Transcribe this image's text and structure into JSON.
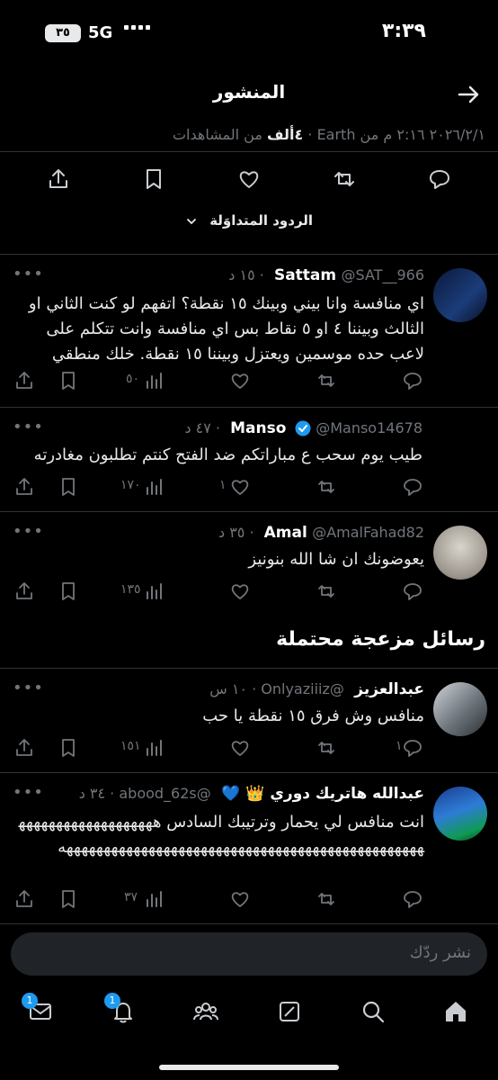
{
  "status_bar": {
    "time": "٣:٣٩",
    "network": "5G",
    "battery": "٣٥"
  },
  "header": {
    "title": "المنشور"
  },
  "post_meta": {
    "date_time": "٢٠٢٦/٢/١ ٢:١٦ م من Earth ·",
    "views_count": "٤ألف",
    "views_label": "من المشاهدات"
  },
  "sort": {
    "label": "الردود المتداوَلة"
  },
  "replies": [
    {
      "name": "Sattam",
      "handle": "@SAT__966 · ١٥ د",
      "text": "اي منافسة وانا بيني وبينك ١٥ نقطة؟ اتفهم لو كنت الثاني او الثالث وبيننا ٤ او ٥ نقاط بس اي منافسة وانت تتكلم على لاعب حده موسمين ويعتزل وبيننا ١٥ نقطة. خلك منطقي",
      "replies": "",
      "likes": "",
      "views": "٥٠"
    },
    {
      "name": "Manso",
      "handle": "@Manso14678 · ٤٧ د",
      "text": "طيب يوم سحب ع مباراتكم ضد الفتح كنتم تطلبون مغادرته",
      "replies": "",
      "likes": "١",
      "views": "١٧٠"
    },
    {
      "name": "Amal",
      "handle": "@AmalFahad82 · ٣٥ د",
      "text": "يعوضونك ان شا الله بنونيز",
      "replies": "",
      "likes": "",
      "views": "١٣٥"
    },
    {
      "name": "عبدالعزيز",
      "handle": "@Onlyaziiiz · ١٠ س",
      "text": "منافس وش فرق ١٥ نقطة يا حب",
      "replies": "١",
      "likes": "",
      "views": "١٥١"
    },
    {
      "name": "عبدالله هاتريك دوري 👑 💙",
      "handle": "@abood_62s · ٣٤ د",
      "text": "انت منافس لي يحمار وترتيبك السادس هههههههههههههههههههههههههههههههههههههههههههههههههههههههههههههههههههه",
      "replies": "",
      "likes": "",
      "views": "٣٧"
    }
  ],
  "section": {
    "title": "رسائل مزعجة محتملة"
  },
  "composer": {
    "placeholder": "نشر ردّك"
  },
  "tabbar": {
    "messages_badge": "1",
    "notifications_badge": "1"
  },
  "colors": {
    "accent": "#1d9bf0",
    "background": "#000000",
    "muted": "#71767b"
  }
}
